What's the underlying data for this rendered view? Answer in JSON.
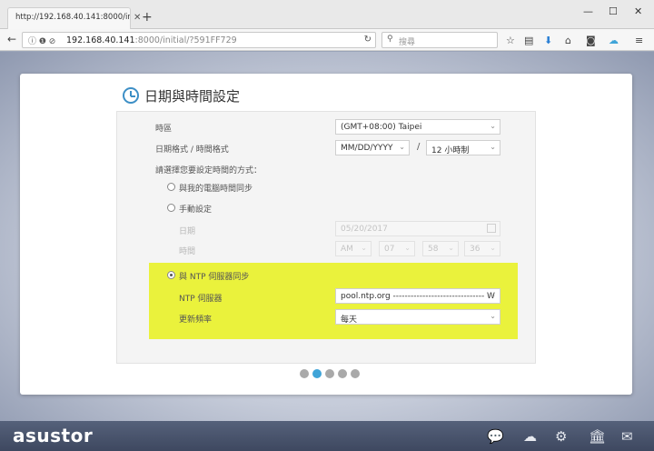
{
  "browser": {
    "tab_title": "http://192.168.40.141:8000/ini",
    "tab_close": "✕",
    "new_tab": "+",
    "minimize": "—",
    "maximize": "☐",
    "close": "✕",
    "url_host": "192.168.40.141",
    "url_rest": ":8000/initial/?591FF729",
    "search_placeholder": "搜尋"
  },
  "wizard": {
    "title": "日期與時間設定",
    "timezone_label": "時區",
    "timezone_value": "(GMT+08:00) Taipei",
    "format_label": "日期格式 / 時間格式",
    "date_format": "MM/DD/YYYY",
    "separator": "/",
    "time_format": "12 小時制",
    "method_prompt": "請選擇您要設定時間的方式：",
    "option_pc_sync": "與我的電腦時間同步",
    "option_manual": "手動設定",
    "date_label": "日期",
    "date_value": "05/20/2017",
    "time_label": "時間",
    "time_ampm": "AM",
    "time_hour": "07",
    "time_min": "58",
    "time_sec": "36",
    "option_ntp": "與 NTP 伺服器同步",
    "ntp_server_label": "NTP 伺服器",
    "ntp_server_value": "pool.ntp.org ------------------------------- W",
    "update_freq_label": "更新頻率",
    "update_freq_value": "每天",
    "step_count": 5,
    "active_step": 2
  },
  "footer": {
    "logo": "asustor"
  },
  "colors": {
    "accent": "#3fa4d8",
    "highlight": "#eaf23c"
  }
}
